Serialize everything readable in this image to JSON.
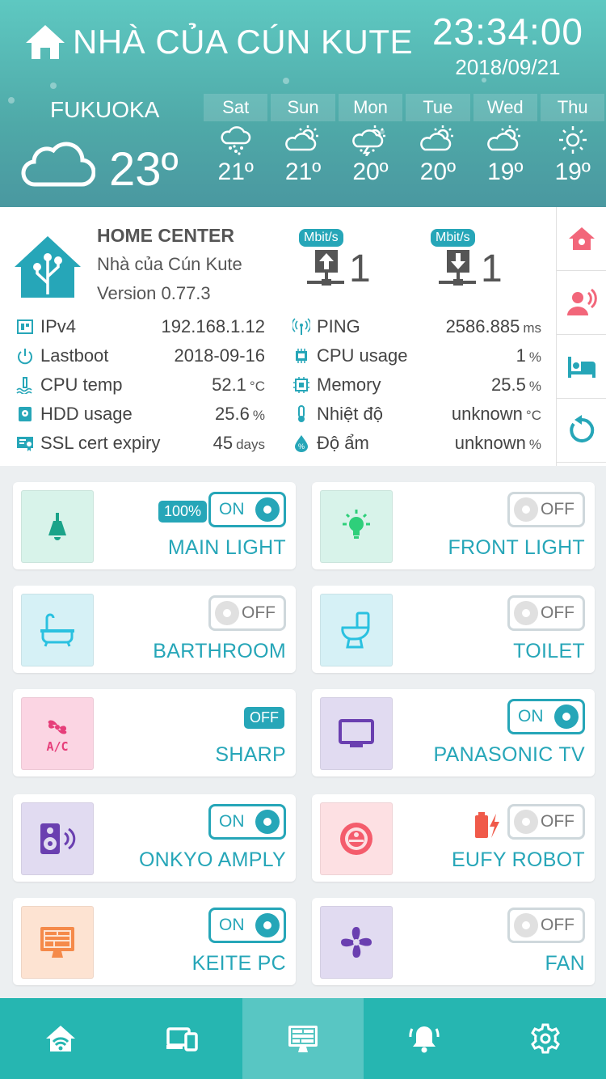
{
  "header": {
    "title": "NHÀ CỦA CÚN KUTE",
    "time": "23:34:00",
    "date": "2018/09/21",
    "city": "FUKUOKA",
    "current_temp": "23º",
    "current_icon": "cloud-icon",
    "forecast": [
      {
        "day": "Sat",
        "temp": "21º",
        "icon": "snow-cloud-icon"
      },
      {
        "day": "Sun",
        "temp": "21º",
        "icon": "partly-cloudy-icon"
      },
      {
        "day": "Mon",
        "temp": "20º",
        "icon": "thunder-cloud-icon"
      },
      {
        "day": "Tue",
        "temp": "20º",
        "icon": "partly-cloudy-icon"
      },
      {
        "day": "Wed",
        "temp": "19º",
        "icon": "partly-cloudy-icon"
      },
      {
        "day": "Thu",
        "temp": "19º",
        "icon": "sun-icon"
      }
    ]
  },
  "info": {
    "title": "HOME CENTER",
    "name": "Nhà của Cún Kute",
    "version": "Version 0.77.3",
    "upload": {
      "badge": "Mbit/s",
      "value": "1"
    },
    "download": {
      "badge": "Mbit/s",
      "value": "1"
    },
    "left_rows": [
      {
        "label": "IPv4",
        "value": "192.168.1.12",
        "unit": ""
      },
      {
        "label": "Lastboot",
        "value": "2018-09-16",
        "unit": ""
      },
      {
        "label": "CPU temp",
        "value": "52.1",
        "unit": "°C"
      },
      {
        "label": "HDD usage",
        "value": "25.6",
        "unit": "%"
      },
      {
        "label": "SSL cert expiry",
        "value": "45",
        "unit": "days"
      }
    ],
    "right_rows": [
      {
        "label": "PING",
        "value": "2586.885",
        "unit": "ms"
      },
      {
        "label": "CPU usage",
        "value": "1",
        "unit": "%"
      },
      {
        "label": "Memory",
        "value": "25.5",
        "unit": "%"
      },
      {
        "label": "Nhiệt độ",
        "value": "unknown",
        "unit": "°C"
      },
      {
        "label": "Độ ẩm",
        "value": "unknown",
        "unit": "%"
      }
    ]
  },
  "side_buttons": [
    "home-alarm-icon",
    "voice-icon",
    "bed-icon",
    "refresh-icon"
  ],
  "devices": [
    {
      "label": "MAIN LIGHT",
      "state": "ON",
      "badge": "100%",
      "icon": "ceiling-lamp-icon",
      "color": "#d8f3ea"
    },
    {
      "label": "FRONT LIGHT",
      "state": "OFF",
      "icon": "light-bulb-icon",
      "color": "#d8f3ea"
    },
    {
      "label": "BARTHROOM",
      "state": "OFF",
      "icon": "bathtub-icon",
      "color": "#d6f1f6"
    },
    {
      "label": "TOILET",
      "state": "OFF",
      "icon": "toilet-icon",
      "color": "#d6f1f6"
    },
    {
      "label": "SHARP",
      "state_badge": "OFF",
      "icon": "air-conditioner-icon",
      "color": "#fbd5e3"
    },
    {
      "label": "PANASONIC TV",
      "state": "ON",
      "icon": "tv-icon",
      "color": "#e1dbf1"
    },
    {
      "label": "ONKYO AMPLY",
      "state": "ON",
      "icon": "speaker-icon",
      "color": "#e1dbf1"
    },
    {
      "label": "EUFY ROBOT",
      "state": "OFF",
      "icon": "robot-vacuum-icon",
      "color": "#fde0e3"
    },
    {
      "label": "KEITE PC",
      "state": "ON",
      "icon": "monitor-icon",
      "color": "#fde3d2"
    },
    {
      "label": "FAN",
      "state": "OFF",
      "icon": "fan-icon",
      "color": "#e1dbf1"
    }
  ],
  "nav": [
    "home-wifi-icon",
    "devices-icon",
    "dashboard-monitor-icon",
    "bell-icon",
    "settings-icon"
  ],
  "colors": {
    "accent": "#26a6b8",
    "nav": "#26b6b1",
    "header": "#4fa9a8"
  }
}
